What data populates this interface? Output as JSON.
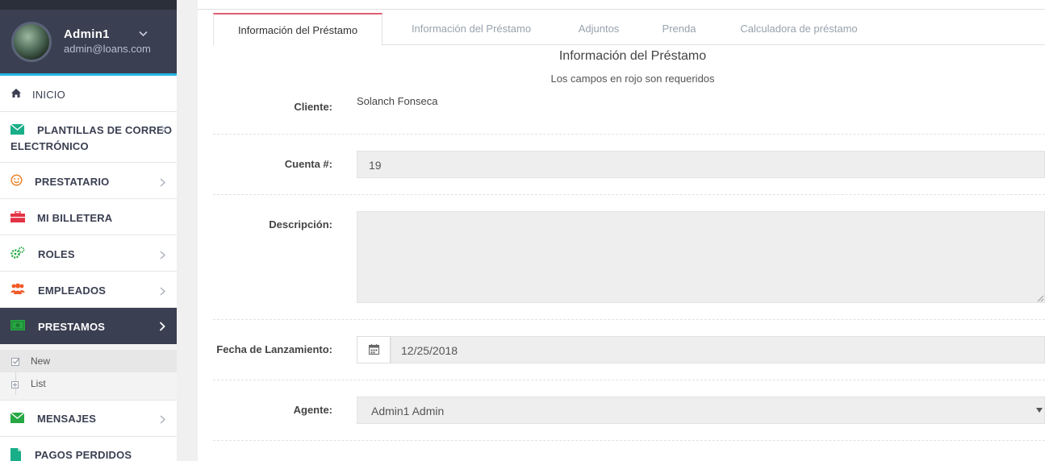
{
  "user": {
    "name": "Admin1",
    "email": "admin@loans.com"
  },
  "sidebar": {
    "items": [
      {
        "label": "INICIO",
        "icon": "home-icon",
        "color": "#3a3f51"
      },
      {
        "label": "PLANTILLAS DE CORREO",
        "label2": "ELECTRÓNICO",
        "icon": "envelope-icon",
        "color": "#1aae88"
      },
      {
        "label": "PRESTATARIO",
        "icon": "smile-icon",
        "color": "#e8832a"
      },
      {
        "label": "MI BILLETERA",
        "icon": "briefcase-icon",
        "color": "#e33244"
      },
      {
        "label": "ROLES",
        "icon": "cogs-icon",
        "color": "#27a844"
      },
      {
        "label": "EMPLEADOS",
        "icon": "users-icon",
        "color": "#f05a28"
      },
      {
        "label": "PRESTAMOS",
        "icon": "money-icon",
        "color": "#27a844"
      },
      {
        "label": "MENSAJES",
        "icon": "envelope-icon",
        "color": "#27a844"
      },
      {
        "label": "PAGOS PERDIDOS",
        "icon": "file-icon",
        "color": "#1aae88"
      }
    ],
    "submenu": [
      {
        "label": "New",
        "icon": "check-square-icon"
      },
      {
        "label": "List",
        "icon": "plus-square-icon"
      }
    ]
  },
  "tabs": [
    {
      "label": "Información del Préstamo"
    },
    {
      "label": "Información del Préstamo"
    },
    {
      "label": "Adjuntos"
    },
    {
      "label": "Prenda"
    },
    {
      "label": "Calculadora de préstamo"
    }
  ],
  "form": {
    "title": "Información del Préstamo",
    "subtitle": "Los campos en rojo son requeridos",
    "cliente_label": "Cliente:",
    "cliente_value": "Solanch Fonseca",
    "cuenta_label": "Cuenta #:",
    "cuenta_value": "19",
    "descripcion_label": "Descripción:",
    "descripcion_value": "",
    "fecha_label": "Fecha de Lanzamiento:",
    "fecha_value": "12/25/2018",
    "agente_label": "Agente:",
    "agente_value": "Admin1 Admin"
  }
}
